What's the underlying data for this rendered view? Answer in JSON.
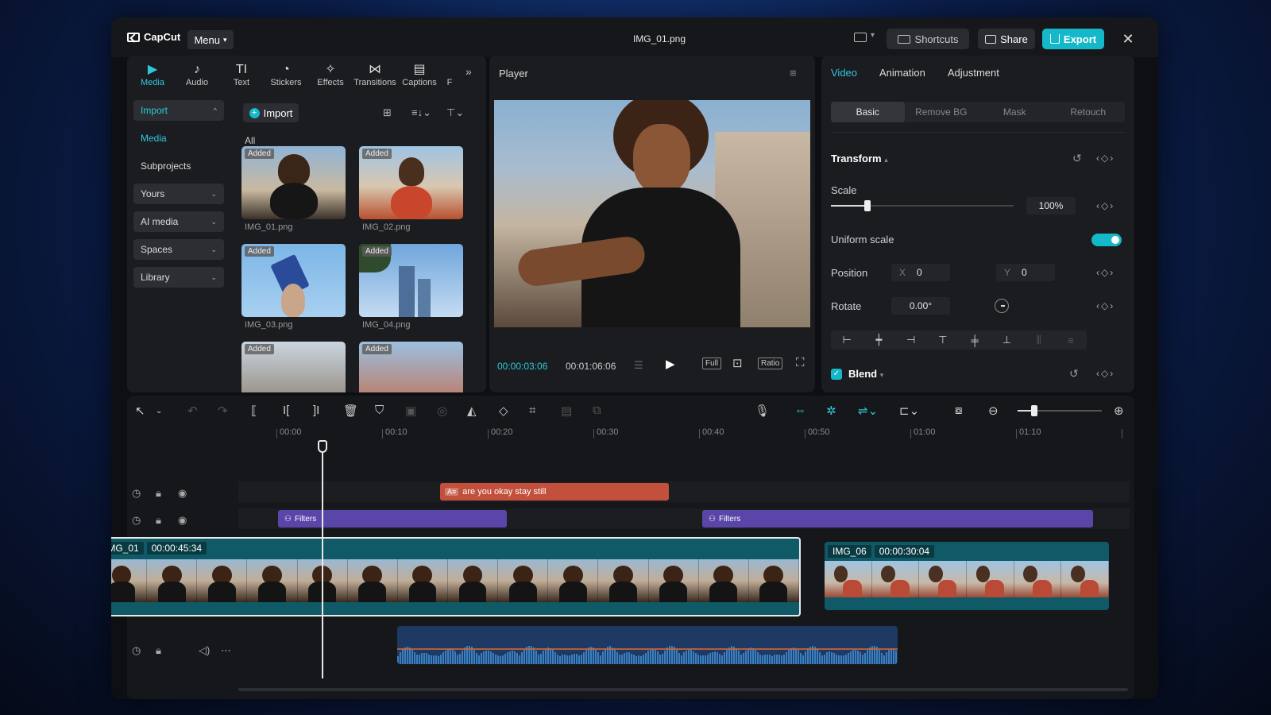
{
  "app": {
    "logo": "CapCut",
    "menu_label": "Menu",
    "document_title": "IMG_01.png",
    "shortcuts_label": "Shortcuts",
    "share_label": "Share",
    "export_label": "Export"
  },
  "media_panel": {
    "tabs": [
      {
        "label": "Media",
        "icon": "media-icon"
      },
      {
        "label": "Audio",
        "icon": "audio-icon"
      },
      {
        "label": "Text",
        "icon": "text-icon"
      },
      {
        "label": "Stickers",
        "icon": "stickers-icon"
      },
      {
        "label": "Effects",
        "icon": "effects-icon"
      },
      {
        "label": "Transitions",
        "icon": "transitions-icon"
      },
      {
        "label": "Captions",
        "icon": "captions-icon"
      },
      {
        "label": "F",
        "icon": "filters-icon"
      }
    ],
    "nav": {
      "import": "Import",
      "media": "Media",
      "subprojects": "Subprojects",
      "yours": "Yours",
      "ai_media": "AI media",
      "spaces": "Spaces",
      "library": "Library"
    },
    "import_button": "Import",
    "all_label": "All",
    "added_badge": "Added",
    "items": [
      {
        "name": "IMG_01.png"
      },
      {
        "name": "IMG_02.png"
      },
      {
        "name": "IMG_03.png"
      },
      {
        "name": "IMG_04.png"
      }
    ]
  },
  "player": {
    "title": "Player",
    "current_time": "00:00:03:06",
    "total_time": "00:01:06:06",
    "full_label": "Full",
    "ratio_label": "Ratio"
  },
  "properties": {
    "tabs": [
      "Video",
      "Animation",
      "Adjustment"
    ],
    "sub_tabs": [
      "Basic",
      "Remove BG",
      "Mask",
      "Retouch"
    ],
    "transform_label": "Transform",
    "scale_label": "Scale",
    "scale_value": "100%",
    "scale_fraction": 0.2,
    "uniform_scale_label": "Uniform scale",
    "uniform_scale_on": true,
    "position_label": "Position",
    "position_x_axis": "X",
    "position_x": "0",
    "position_y_axis": "Y",
    "position_y": "0",
    "rotate_label": "Rotate",
    "rotate_value": "0.00°",
    "blend_label": "Blend"
  },
  "timeline": {
    "ruler": [
      "00:00",
      "00:10",
      "00:20",
      "00:30",
      "00:40",
      "00:50",
      "01:00",
      "01:10"
    ],
    "text_clip_label": "are you okay stay still",
    "text_clip_badge": "A≡",
    "filter_label": "Filters",
    "main_clip_name": "IMG_01",
    "main_clip_duration": "00:00:45:34",
    "second_clip_name": "IMG_06",
    "second_clip_duration": "00:00:30:04",
    "zoom_fraction": 0.2
  },
  "colors": {
    "accent": "#14b8c8",
    "text_clip": "#c2503c",
    "filter_clip": "#5a45a8",
    "video_track": "#0f5a66",
    "audio_clip": "#1e3a64"
  }
}
